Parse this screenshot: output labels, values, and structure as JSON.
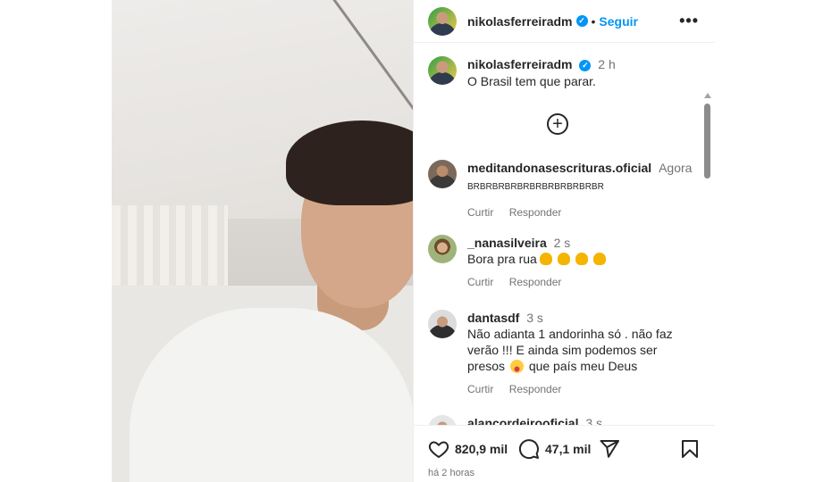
{
  "post": {
    "author": "nikolasferreiradm",
    "follow_label": "Seguir",
    "more_label": "•••",
    "separator": "•"
  },
  "caption": {
    "username": "nikolasferreiradm",
    "time": "2 h",
    "text": "O Brasil tem que parar."
  },
  "comments": [
    {
      "username": "meditandonasescrituras.oficial",
      "time": "Agora",
      "text": "BRBRBRBRBRBRBRBRBRBRBR",
      "reply_label": "Curtir",
      "respond_label": "Responder"
    },
    {
      "username": "_nanasilveira",
      "time": "2 s",
      "text": "Bora pra rua",
      "reply_label": "Curtir",
      "respond_label": "Responder"
    },
    {
      "username": "dantasdf",
      "time": "3 s",
      "text_line1": "Não adianta 1 andorinha só . não faz",
      "text_line2": "verão !!! E ainda sim podemos ser",
      "text_line3_a": "presos",
      "text_line3_b": "que país meu Deus",
      "reply_label": "Curtir",
      "respond_label": "Responder"
    },
    {
      "username": "alancordeirooficial",
      "time": "3 s"
    }
  ],
  "footer": {
    "likes": "820,9 mil",
    "comments": "47,1 mil",
    "timestamp": "há 2 horas"
  },
  "icons": {
    "verified": "verified-badge-icon",
    "add": "plus-circle-icon",
    "like": "heart-icon",
    "comment": "comment-bubble-icon",
    "share": "send-icon",
    "save": "bookmark-icon"
  },
  "colors": {
    "link": "#0095f6",
    "text": "#262626",
    "muted": "#737373"
  }
}
